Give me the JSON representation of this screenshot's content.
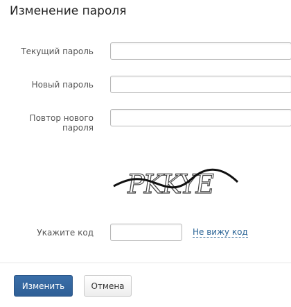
{
  "dialog": {
    "title": "Изменение пароля"
  },
  "form": {
    "current_password_label": "Текущий пароль",
    "current_password_value": "",
    "new_password_label": "Новый пароль",
    "new_password_value": "",
    "repeat_password_label": "Повтор нового пароля",
    "repeat_password_value": "",
    "code_label": "Укажите код",
    "code_value": "",
    "cant_see_code_link": "Не вижу код"
  },
  "captcha": {
    "text": "PKKYE"
  },
  "buttons": {
    "submit_label": "Изменить",
    "cancel_label": "Отмена"
  },
  "colors": {
    "primary_button": "#2f5f96",
    "link": "#2a6496"
  }
}
